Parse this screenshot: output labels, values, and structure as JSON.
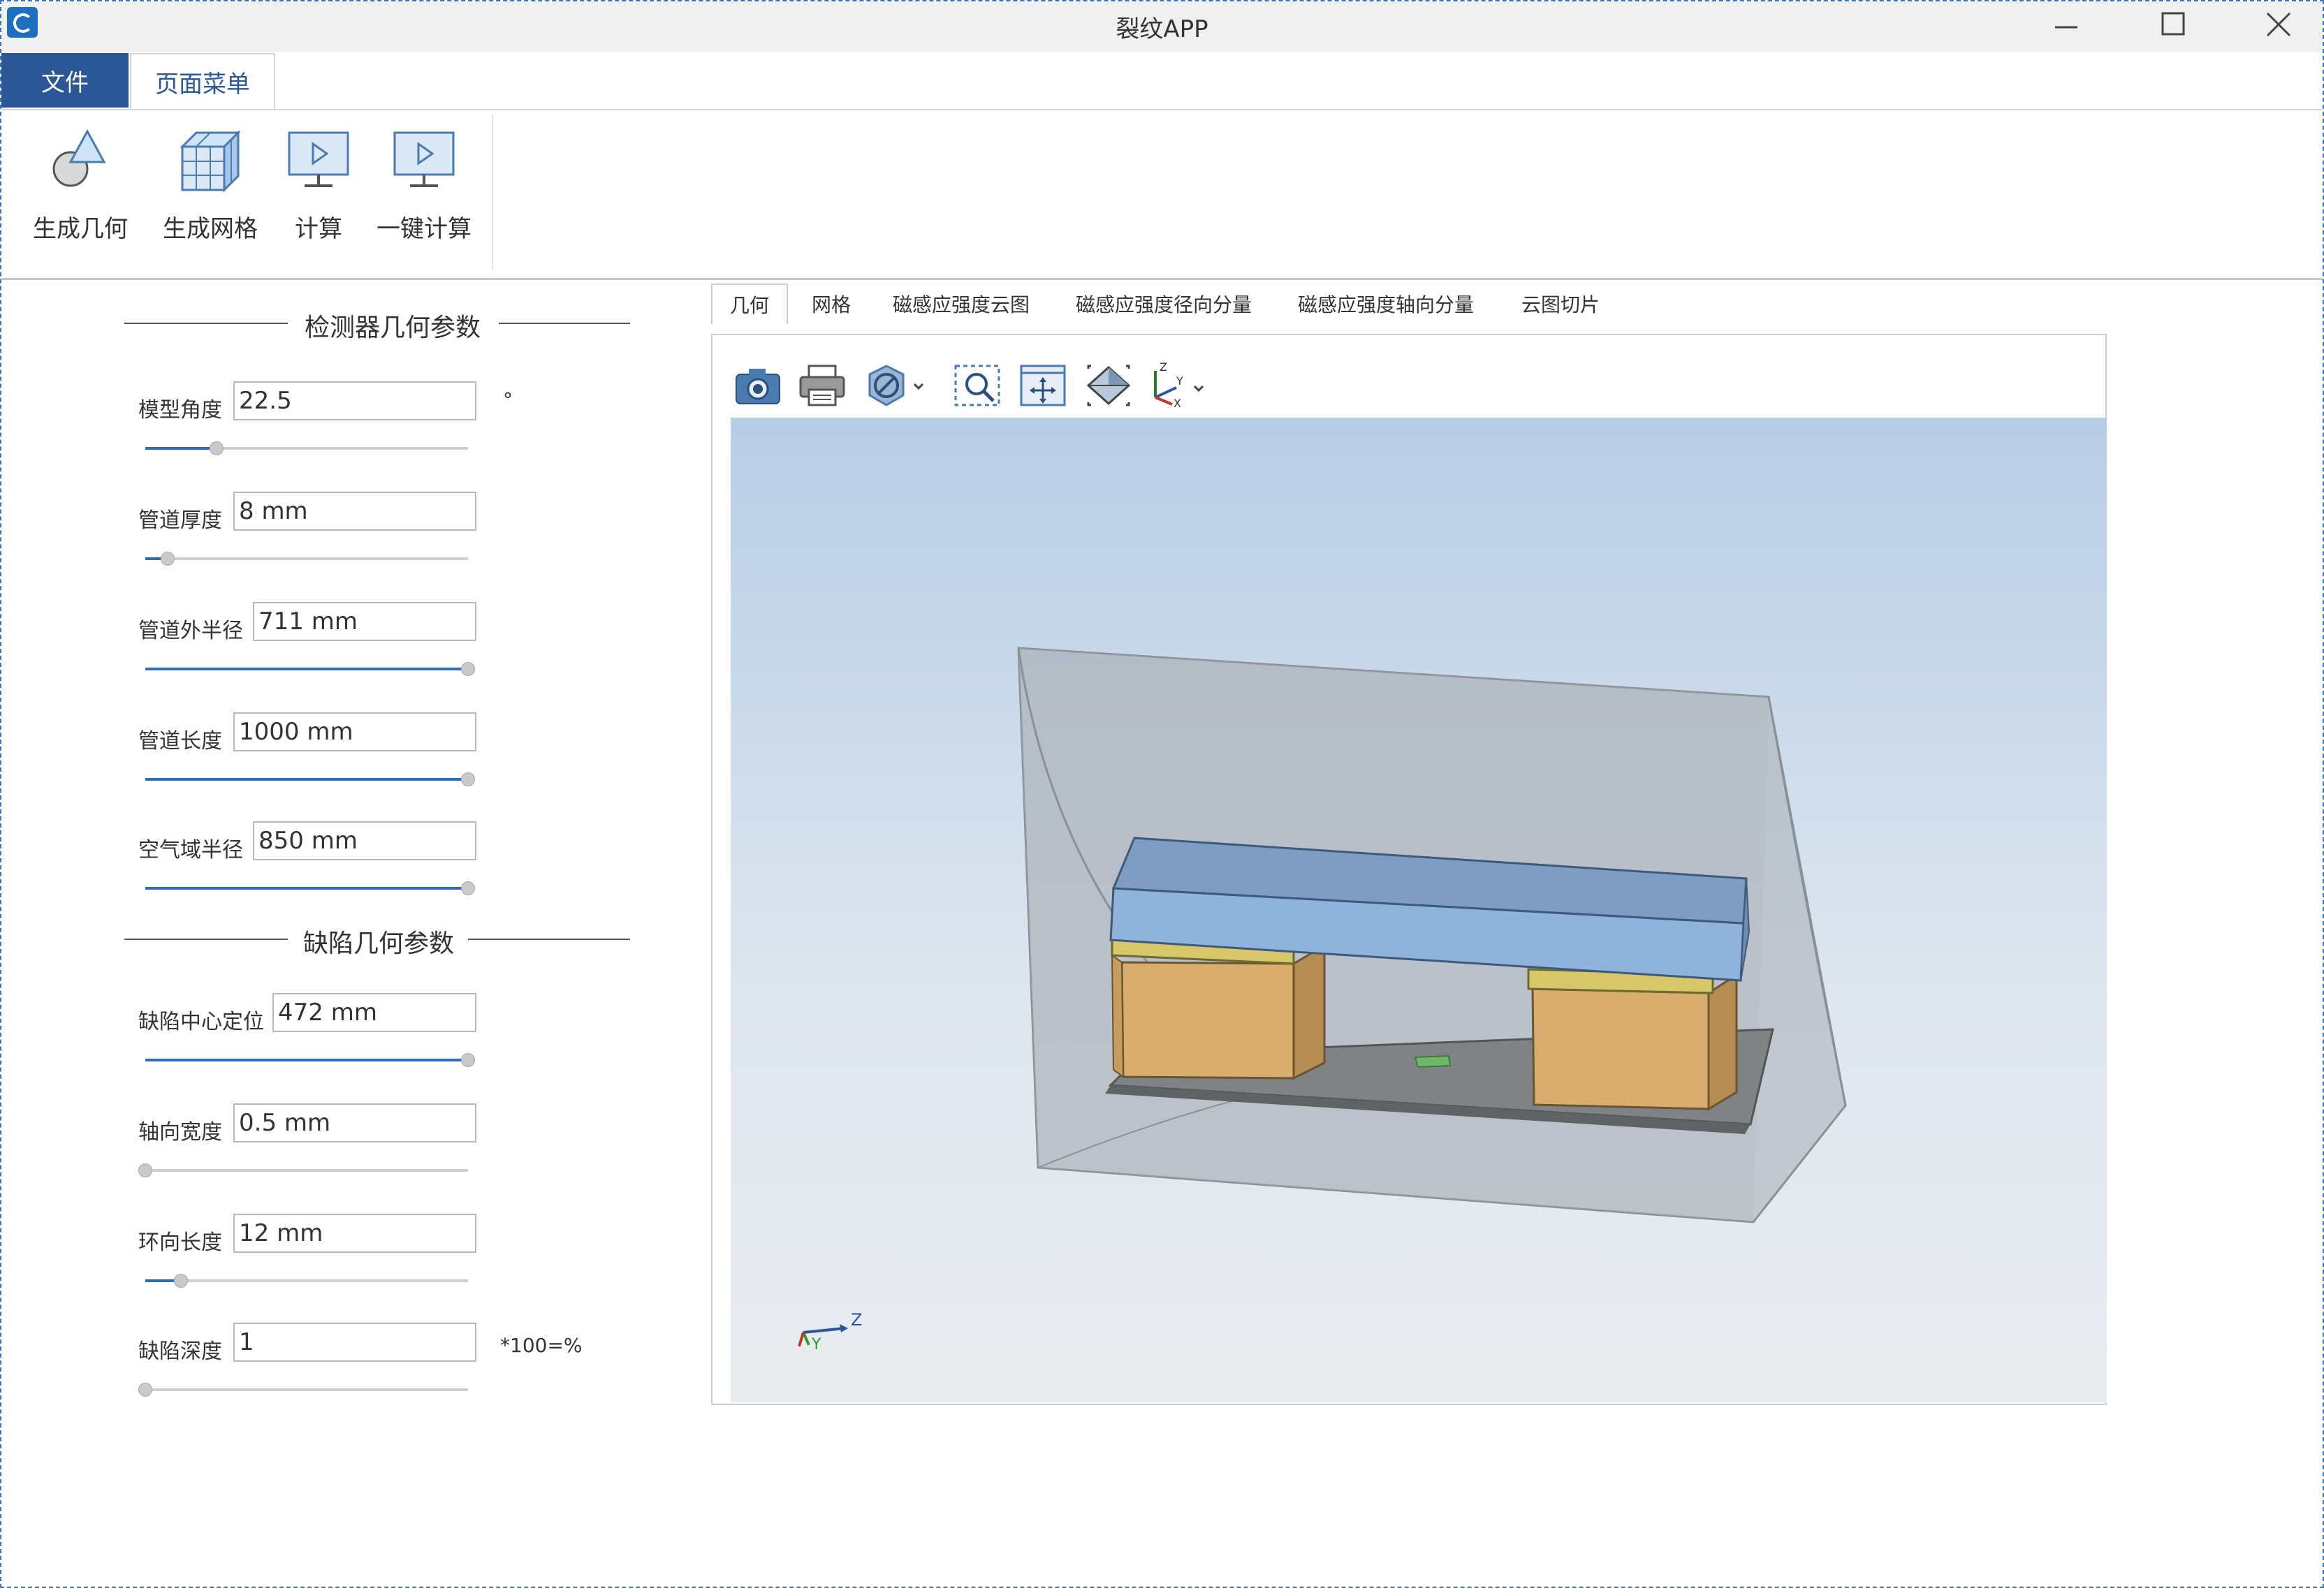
{
  "window": {
    "title": "裂纹APP",
    "icons": [
      "app-icon",
      "minimize-icon",
      "maximize-icon",
      "close-icon"
    ]
  },
  "menu": {
    "file": "文件",
    "page_menu": "页面菜单"
  },
  "ribbon": {
    "buttons": [
      {
        "label": "生成几何",
        "icon": "geometry-icon"
      },
      {
        "label": "生成网格",
        "icon": "mesh-cube-icon"
      },
      {
        "label": "计算",
        "icon": "compute-monitor-icon"
      },
      {
        "label": "一键计算",
        "icon": "one-click-compute-icon"
      }
    ]
  },
  "detector_section": {
    "title": "检测器几何参数",
    "params": [
      {
        "label": "模型角度",
        "value": "22.5",
        "unit": "°",
        "slider_fraction": 0.22
      },
      {
        "label": "管道厚度",
        "value": "8 mm",
        "unit": "",
        "slider_fraction": 0.07
      },
      {
        "label": "管道外半径",
        "value": "711 mm",
        "unit": "",
        "slider_fraction": 1.0
      },
      {
        "label": "管道长度",
        "value": "1000 mm",
        "unit": "",
        "slider_fraction": 1.0
      },
      {
        "label": "空气域半径",
        "value": "850 mm",
        "unit": "",
        "slider_fraction": 1.0
      }
    ]
  },
  "defect_section": {
    "title": "缺陷几何参数",
    "params": [
      {
        "label": "缺陷中心定位",
        "value": "472 mm",
        "unit": "",
        "slider_fraction": 1.0
      },
      {
        "label": "轴向宽度",
        "value": "0.5 mm",
        "unit": "",
        "slider_fraction": 0.0
      },
      {
        "label": "环向长度",
        "value": "12 mm",
        "unit": "",
        "slider_fraction": 0.11
      },
      {
        "label": "缺陷深度",
        "value": "1",
        "unit": "*100=%",
        "slider_fraction": 0.0
      }
    ]
  },
  "view_tabs": [
    "几何",
    "网格",
    "磁感应强度云图",
    "磁感应强度径向分量",
    "磁感应强度轴向分量",
    "云图切片"
  ],
  "active_view_tab": "几何",
  "viewer_toolbar": [
    "camera-icon",
    "print-icon",
    "hide-icon",
    "zoom-box-icon",
    "zoom-extents-icon",
    "view-isometric-icon",
    "axis-orientation-icon"
  ],
  "axis_triad": {
    "z": "Z",
    "y": "Y"
  },
  "colors": {
    "accent": "#2b5797",
    "slider_fill": "#2f6fb5",
    "ferrite_yellow": "#d8c66a",
    "magnet_brown": "#d9ad6e",
    "yoke_blue": "#8fb3db"
  }
}
